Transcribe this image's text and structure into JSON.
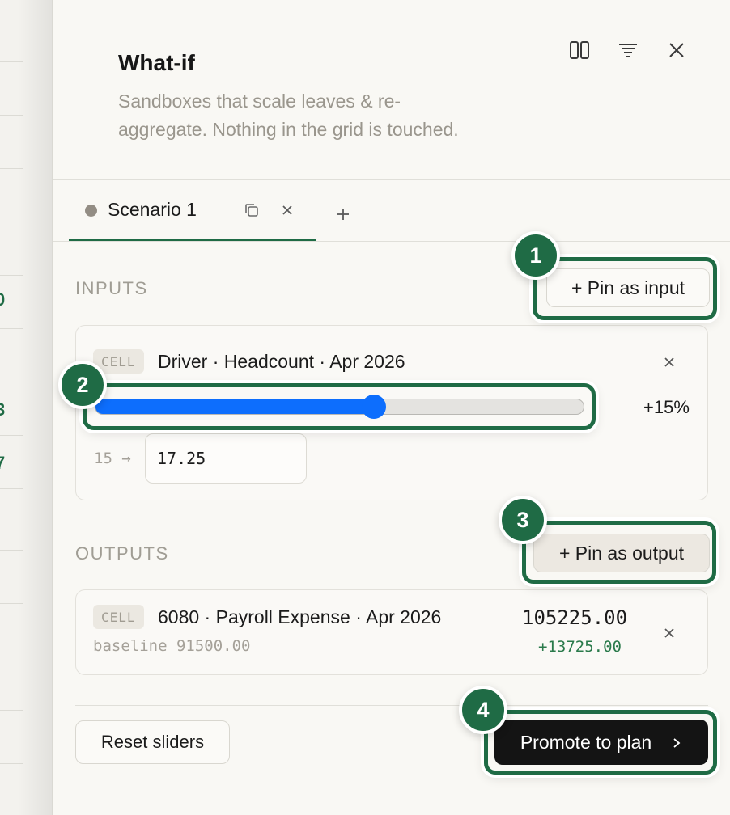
{
  "panel": {
    "title": "What-if",
    "subtitle": "Sandboxes that scale leaves & re-aggregate. Nothing in the grid is touched.",
    "header_icons": [
      "columns-icon",
      "filter-icon",
      "close-icon"
    ]
  },
  "backdrop": {
    "marks": [
      "0",
      "3",
      "7"
    ]
  },
  "tabs": [
    {
      "label": "Scenario 1",
      "active": true
    }
  ],
  "inputs": {
    "section_label": "INPUTS",
    "pin_button": "+ Pin as input",
    "items": [
      {
        "chip": "CELL",
        "title": "Driver · Headcount · Apr 2026",
        "slider_fraction": 0.57,
        "slider_label": "+15%",
        "from_label": "15 →",
        "value": "17.25"
      }
    ]
  },
  "outputs": {
    "section_label": "OUTPUTS",
    "pin_button": "+ Pin as output",
    "items": [
      {
        "chip": "CELL",
        "title": "6080 · Payroll Expense · Apr 2026",
        "baseline": "baseline 91500.00",
        "value": "105225.00",
        "delta": "+13725.00"
      }
    ]
  },
  "footer": {
    "reset_label": "Reset sliders",
    "promote_label": "Promote to plan"
  },
  "annotations": [
    "1",
    "2",
    "3",
    "4"
  ],
  "colors": {
    "accent": "#1f6b45",
    "slider": "#0d6efd",
    "promote_bg": "#141414",
    "delta_positive": "#2a7a4b"
  }
}
